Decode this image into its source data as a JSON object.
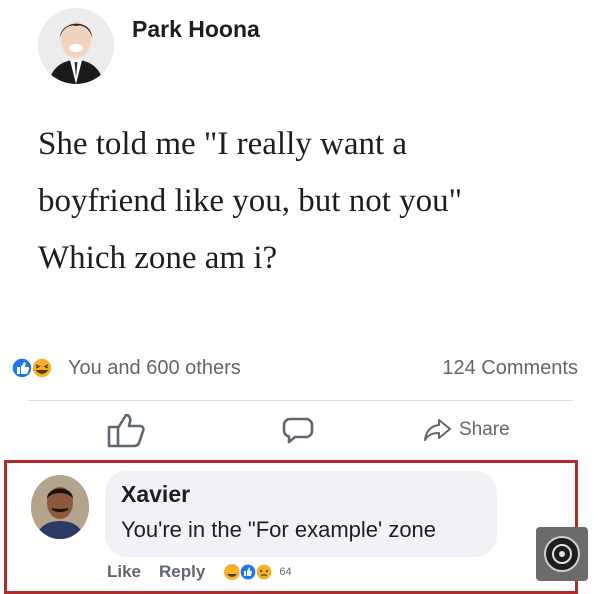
{
  "post": {
    "author": "Park Hoona",
    "text_lines": [
      "She told me \"I really want a",
      "boyfriend like you, but not you\"",
      "Which zone am i?"
    ],
    "reactions_summary": "You and 600 others",
    "comments_count": "124 Comments",
    "reaction_icons": [
      "like-reaction-icon",
      "haha-reaction-icon"
    ]
  },
  "actions": {
    "share_label": "Share"
  },
  "comment": {
    "author": "Xavier",
    "text": "You're in the \"For example' zone",
    "like_label": "Like",
    "reply_label": "Reply",
    "reaction_count": "64",
    "reaction_icons": [
      "haha-reaction-icon",
      "like-reaction-icon",
      "sad-reaction-icon"
    ]
  },
  "colors": {
    "like_blue": "#1877f2",
    "reaction_yellow": "#f7b125",
    "highlight_border": "#b02b2b",
    "secondary_text": "#606770"
  }
}
